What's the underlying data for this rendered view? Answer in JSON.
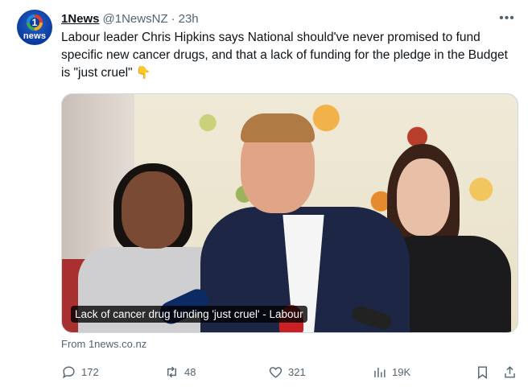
{
  "tweet": {
    "author_name": "1News",
    "author_handle": "@1NewsNZ",
    "separator": "·",
    "time": "23h",
    "more_label": "•••",
    "text": "Labour leader Chris Hipkins says National should've never promised to fund specific new cancer drugs, and that a lack of funding for the pledge in the Budget is \"just cruel\"",
    "emoji": "👇",
    "avatar": {
      "top_text": "1",
      "bottom_text": "news",
      "brand_color": "#0b3ea6"
    },
    "media": {
      "caption": "Lack of cancer drug funding 'just cruel' - Labour"
    },
    "source": "From 1news.co.nz"
  },
  "actions": {
    "reply": {
      "icon": "reply-icon",
      "count": "172"
    },
    "retweet": {
      "icon": "retweet-icon",
      "count": "48"
    },
    "like": {
      "icon": "heart-icon",
      "count": "321"
    },
    "views": {
      "icon": "views-icon",
      "count": "19K"
    },
    "bookmark": {
      "icon": "bookmark-icon"
    },
    "share": {
      "icon": "share-icon"
    }
  },
  "colors": {
    "text": "#0f1419",
    "secondary": "#536471",
    "border": "#cfd9de"
  }
}
